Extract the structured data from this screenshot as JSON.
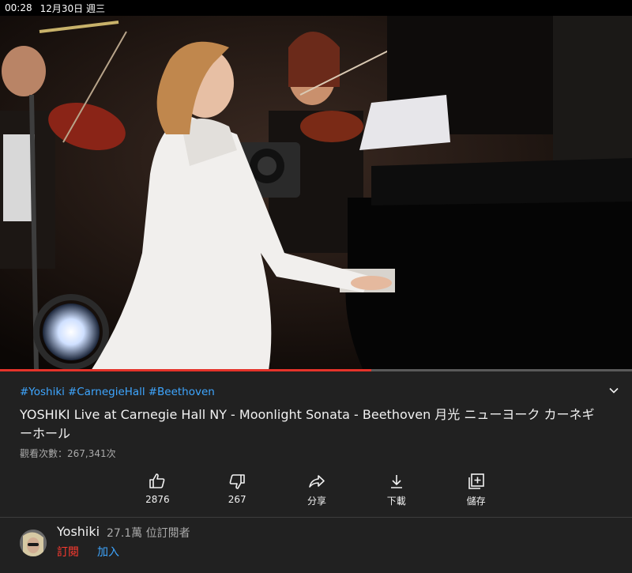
{
  "status_bar": {
    "time": "00:28",
    "date": "12月30日 週三"
  },
  "video": {
    "progress_fraction": 0.587
  },
  "hashtags": [
    "#Yoshiki",
    "#CarnegieHall",
    "#Beethoven"
  ],
  "title": "YOSHIKI Live at Carnegie Hall NY - Moonlight Sonata - Beethoven 月光 ニューヨーク カーネギーホール",
  "views": "觀看次數：267,341次",
  "actions": {
    "like": {
      "label": "2876",
      "icon": "thumbs-up-icon"
    },
    "dislike": {
      "label": "267",
      "icon": "thumbs-down-icon"
    },
    "share": {
      "label": "分享",
      "icon": "share-icon"
    },
    "download": {
      "label": "下載",
      "icon": "download-icon"
    },
    "save": {
      "label": "儲存",
      "icon": "save-playlist-icon"
    }
  },
  "channel": {
    "name": "Yoshiki",
    "subscribers": "27.1萬 位訂閱者",
    "subscribe_label": "訂閱",
    "join_label": "加入"
  },
  "colors": {
    "link": "#3ea6ff",
    "subscribe": "#ff3b30",
    "progress": "#e5332a",
    "background": "#212121"
  }
}
